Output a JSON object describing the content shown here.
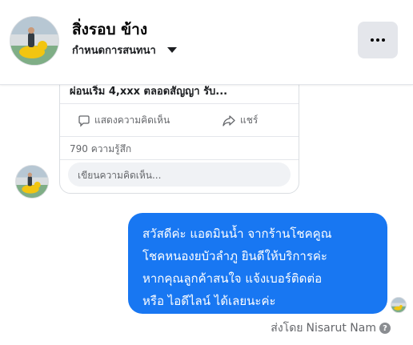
{
  "header": {
    "title": "สิ่งรอบ ข้าง",
    "subtitle": "กำหนดการสนทนา",
    "avatar_icon": "page-avatar-duck-photo",
    "more_icon": "more-horizontal-icon"
  },
  "shared_post": {
    "truncated_text": "ผ่อนเริ่ม 4,xxx ตลอดสัญญา รับ...",
    "comment_action_label": "แสดงความคิดเห็น",
    "share_action_label": "แชร์",
    "reactions_label": "790 ความรู้สึก",
    "comment_placeholder": "เขียนความคิดเห็น..."
  },
  "message": {
    "lines": [
      "สวัสดีค่ะ แอดมินน้ำ จากร้านโชคคูณ",
      "โชคหนองยบัวลำภู ยินดีให้บริการค่ะ",
      "หากคุณลูกค้าสนใจ แจ้งเบอร์ติดต่อ",
      "หรือ ไอดีไลน์ ได้เลยนะค่ะ"
    ],
    "bubble_color": "#1877f2"
  },
  "footer": {
    "sent_by_label": "ส่งโดย",
    "sender_name": "Nisarut Nam",
    "help_symbol": "?"
  },
  "colors": {
    "accent": "#1877f2",
    "secondary_text": "#65676b",
    "button_bg": "#e4e6eb"
  }
}
